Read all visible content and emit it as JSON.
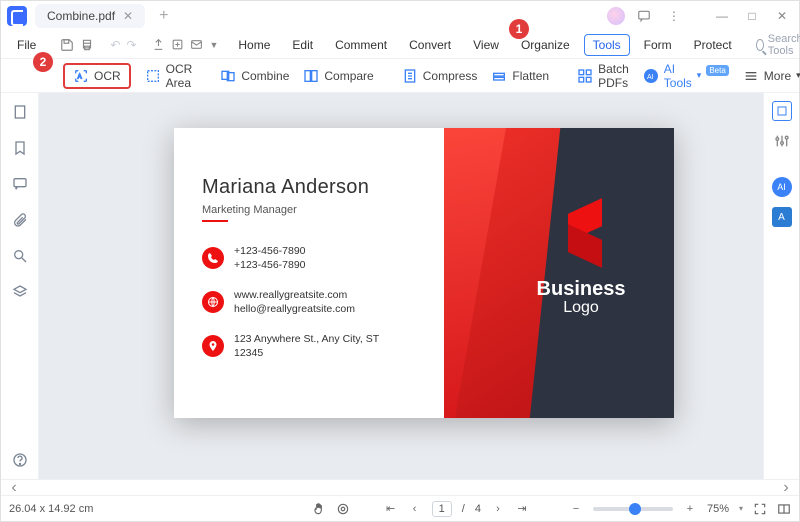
{
  "title": {
    "filename": "Combine.pdf"
  },
  "window": {
    "min": "—",
    "max": "□",
    "close": "✕"
  },
  "menubar": {
    "file": "File",
    "items": [
      "Home",
      "Edit",
      "Comment",
      "Convert",
      "View",
      "Organize",
      "Tools",
      "Form",
      "Protect"
    ],
    "active": "Tools",
    "search": "Search Tools"
  },
  "toolbar": {
    "ocr": "OCR",
    "ocr_area": "OCR Area",
    "combine": "Combine",
    "compare": "Compare",
    "compress": "Compress",
    "flatten": "Flatten",
    "batch": "Batch PDFs",
    "aitools": "AI Tools",
    "beta": "Beta",
    "more": "More"
  },
  "callouts": {
    "one": "1",
    "two": "2"
  },
  "card": {
    "name": "Mariana Anderson",
    "role": "Marketing Manager",
    "phone1": "+123-456-7890",
    "phone2": "+123-456-7890",
    "web": "www.reallygreatsite.com",
    "email": "hello@reallygreatsite.com",
    "addr1": "123 Anywhere St., Any City, ST",
    "addr2": "12345",
    "logo1": "Business",
    "logo2": "Logo"
  },
  "status": {
    "dims": "26.04 x 14.92 cm",
    "page": "1",
    "pages": "4",
    "zoom": "75%"
  }
}
